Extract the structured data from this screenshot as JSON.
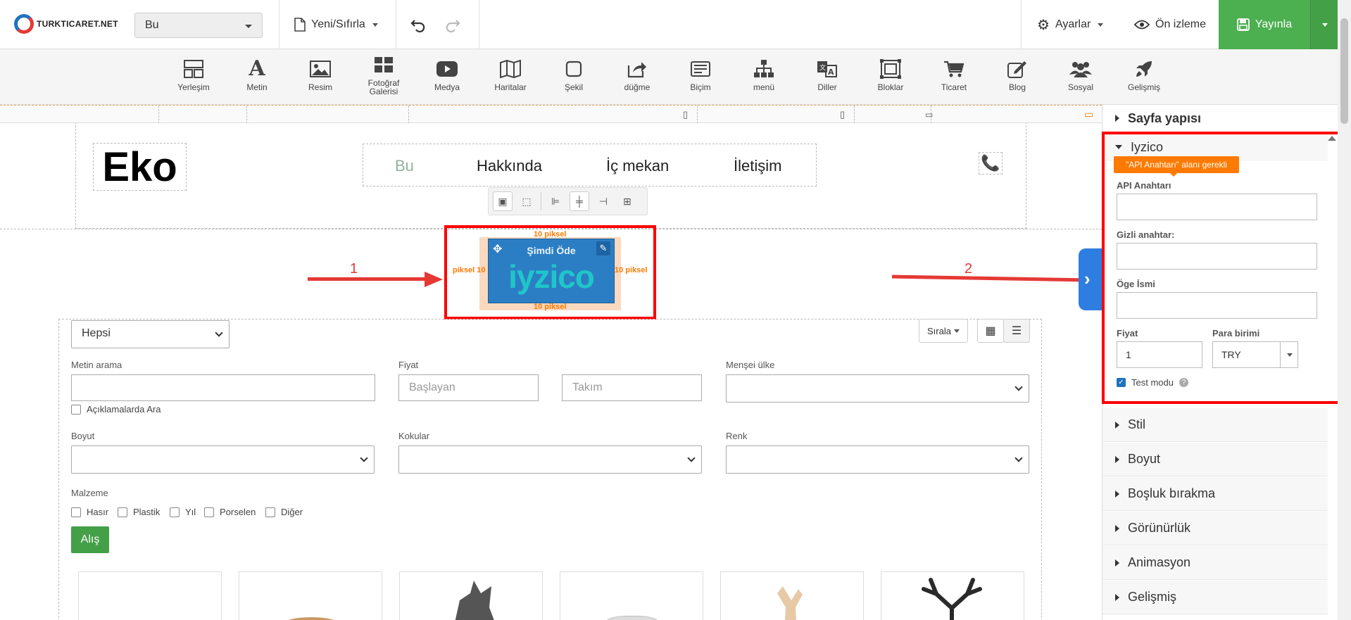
{
  "topbar": {
    "logo_text": "TURKTICARET.NET",
    "page_select": "Bu",
    "new_reset": "Yeni/Sıfırla",
    "settings": "Ayarlar",
    "preview": "Ön izleme",
    "publish": "Yayınla"
  },
  "components": [
    {
      "label": "Yerleşim",
      "icon": "layout-icon"
    },
    {
      "label": "Metin",
      "icon": "text-icon"
    },
    {
      "label": "Resim",
      "icon": "image-icon"
    },
    {
      "label": "Fotoğraf Galerisi",
      "icon": "gallery-icon"
    },
    {
      "label": "Medya",
      "icon": "media-icon"
    },
    {
      "label": "Haritalar",
      "icon": "map-icon"
    },
    {
      "label": "Şekil",
      "icon": "shape-icon"
    },
    {
      "label": "düğme",
      "icon": "button-icon"
    },
    {
      "label": "Biçim",
      "icon": "form-icon"
    },
    {
      "label": "menü",
      "icon": "menu-icon"
    },
    {
      "label": "Diller",
      "icon": "language-icon"
    },
    {
      "label": "Bloklar",
      "icon": "blocks-icon"
    },
    {
      "label": "Ticaret",
      "icon": "cart-icon"
    },
    {
      "label": "Blog",
      "icon": "blog-icon"
    },
    {
      "label": "Sosyal",
      "icon": "social-icon"
    },
    {
      "label": "Gelişmiş",
      "icon": "rocket-icon"
    }
  ],
  "canvas": {
    "logo": "Eko",
    "nav": [
      "Bu",
      "Hakkında",
      "İç mekan",
      "İletişim"
    ],
    "pay_button": {
      "title": "Şimdi Öde",
      "brand": "iyzico",
      "pad_top": "10 piksel",
      "pad_bottom": "10 piksel",
      "pad_left": "piksel 10",
      "pad_right": "10 piksel"
    },
    "annotations": [
      "1",
      "2"
    ],
    "filter": {
      "category": "Hepsi",
      "sort": "Sırala",
      "text_search_label": "Metin arama",
      "search_desc": "Açıklamalarda Ara",
      "price_label": "Fiyat",
      "price_from_placeholder": "Başlayan",
      "price_to_placeholder": "Takım",
      "origin_label": "Menşei ülke",
      "size_label": "Boyut",
      "scents_label": "Kokular",
      "color_label": "Renk",
      "material_label": "Malzeme",
      "materials": [
        "Hasır",
        "Plastik",
        "Yıl",
        "Porselen",
        "Diğer"
      ],
      "buy": "Alış"
    }
  },
  "panel": {
    "page_structure": "Sayfa yapısı",
    "iyzico": "Iyzico",
    "tooltip": "\"API Anahtarı\" alanı gerekli",
    "api_key_label": "API Anahtarı",
    "secret_key_label": "Gizli anahtar:",
    "item_name_label": "Öge İsmi",
    "price_label": "Fiyat",
    "price_value": "1",
    "currency_label": "Para birimi",
    "currency_value": "TRY",
    "test_mode": "Test modu",
    "test_mode_checked": true,
    "sections": [
      "Stil",
      "Boyut",
      "Boşluk bırakma",
      "Görünürlük",
      "Animasyon",
      "Gelişmiş"
    ]
  },
  "colors": {
    "publish_green": "#4caf50",
    "highlight_red": "#ff0000",
    "iyzico_blue": "#2c7ec4",
    "iyzico_teal": "#1fc6c8",
    "tooltip_orange": "#ff7a00",
    "nav_active": "#8fb3a0"
  }
}
